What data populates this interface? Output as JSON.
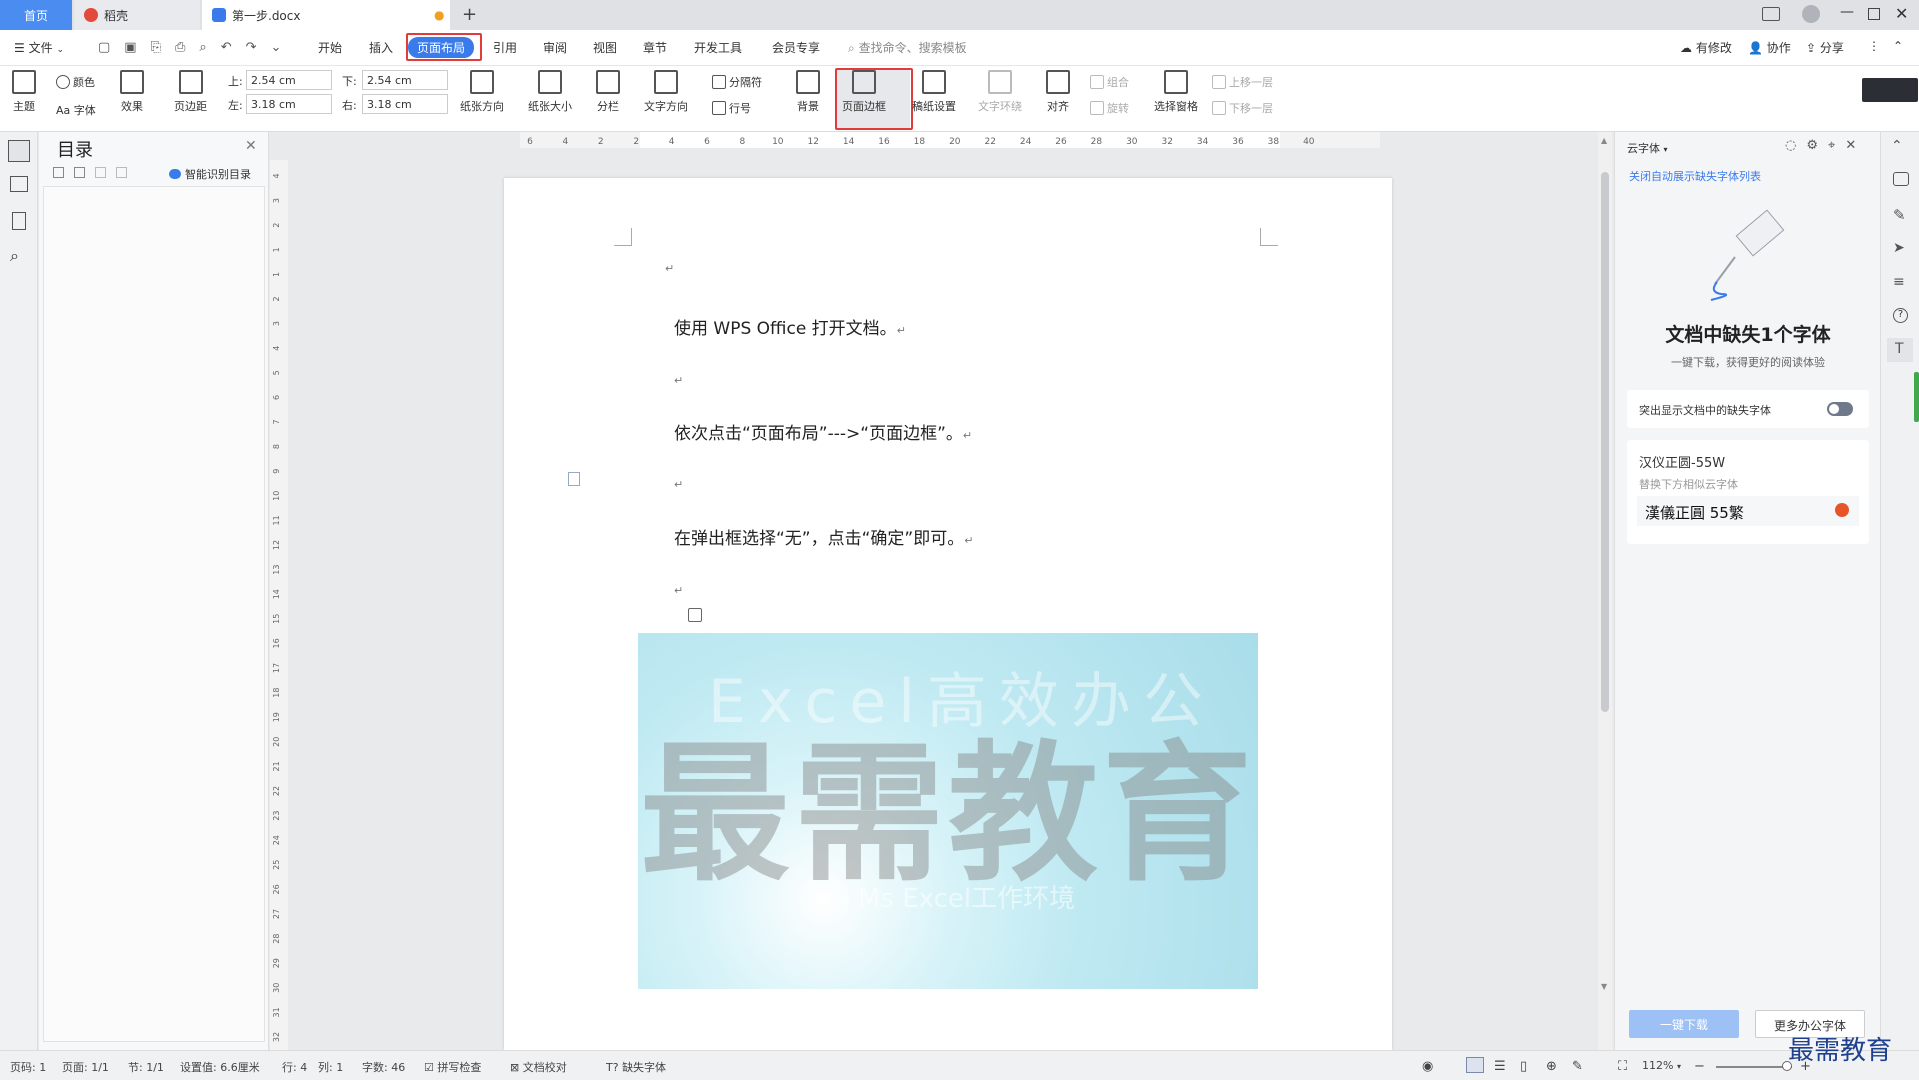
{
  "tabs": {
    "home": "首页",
    "daoke": "稻壳",
    "doc": "第一步.docx"
  },
  "menubar": {
    "file": "文件",
    "items": [
      "开始",
      "插入",
      "页面布局",
      "引用",
      "审阅",
      "视图",
      "章节",
      "开发工具",
      "会员专享"
    ],
    "search": "查找命令、搜索模板",
    "modified": "有修改",
    "collab": "协作",
    "share": "分享"
  },
  "ribbon": {
    "theme": "主题",
    "color": "颜色",
    "font": "Aa 字体",
    "effect": "效果",
    "margin": "页边距",
    "top_label": "上:",
    "top_value": "2.54 cm",
    "bottom_label": "下:",
    "bottom_value": "2.54 cm",
    "left_label": "左:",
    "left_value": "3.18 cm",
    "right_label": "右:",
    "right_value": "3.18 cm",
    "orientation": "纸张方向",
    "size": "纸张大小",
    "columns": "分栏",
    "text_dir": "文字方向",
    "separator": "分隔符",
    "line_no": "行号",
    "background": "背景",
    "page_border": "页面边框",
    "draft": "稿纸设置",
    "wrap": "文字环绕",
    "align": "对齐",
    "group": "组合",
    "rotate": "旋转",
    "select_pane": "选择窗格",
    "bring_forward": "上移一层",
    "send_backward": "下移一层"
  },
  "toc": {
    "title": "目录",
    "smart": "智能识别目录"
  },
  "ruler_top": [
    "6",
    "4",
    "2",
    "2",
    "4",
    "6",
    "8",
    "10",
    "12",
    "14",
    "16",
    "18",
    "20",
    "22",
    "24",
    "26",
    "28",
    "30",
    "32",
    "34",
    "36",
    "38",
    "40"
  ],
  "ruler_left": [
    "4",
    "3",
    "2",
    "1",
    "1",
    "2",
    "3",
    "4",
    "5",
    "6",
    "7",
    "8",
    "9",
    "10",
    "11",
    "12",
    "13",
    "14",
    "15",
    "16",
    "17",
    "18",
    "19",
    "20",
    "21",
    "22",
    "23",
    "24",
    "25",
    "26",
    "27",
    "28",
    "29",
    "30",
    "31",
    "32"
  ],
  "document": {
    "line1": "使用 WPS Office 打开文档。",
    "line2": "依次点击“页面布局”--->“页面边框”。",
    "line3": "在弹出框选择“无”，点击“确定”即可。",
    "return_mark": "↵",
    "watermark_big": "最需教育",
    "watermark_excel": "Excel高效办公",
    "watermark_sub": "Ms Excel工作环境"
  },
  "cloud_font": {
    "header": "云字体",
    "close_auto": "关闭自动展示缺失字体列表",
    "title": "文档中缺失1个字体",
    "subtitle": "一键下载，获得更好的阅读体验",
    "highlight": "突出显示文档中的缺失字体",
    "font_name": "汉仪正圆-55W",
    "replace_hint": "替换下方相似云字体",
    "font_sample": "漢儀正圓 55繁",
    "download_btn": "一键下载",
    "more_btn": "更多办公字体"
  },
  "status": {
    "page_no": "页码: 1",
    "pages": "页面: 1/1",
    "section": "节: 1/1",
    "setting": "设置值: 6.6厘米",
    "row": "行: 4",
    "col": "列: 1",
    "words": "字数: 46",
    "spell": "拼写检查",
    "proof": "文档校对",
    "missing_font": "缺失字体",
    "zoom": "112%"
  },
  "corner_watermark": "最需教育",
  "colors": {
    "accent": "#4a8cf0",
    "highlight_red": "#e23b3b",
    "toggle": "#6e7a8a"
  }
}
